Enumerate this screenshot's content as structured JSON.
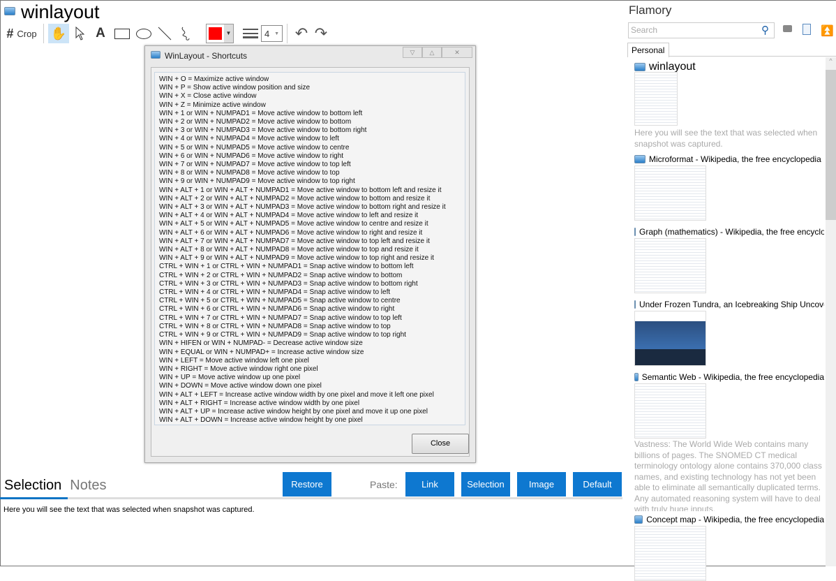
{
  "app": {
    "title": "winlayout"
  },
  "toolbar": {
    "crop_label": "Crop",
    "line_width": "4",
    "color": "#ff0000",
    "tools": [
      "hand",
      "pointer",
      "text",
      "rectangle",
      "ellipse",
      "line",
      "freehand"
    ]
  },
  "dialog": {
    "title": "WinLayout - Shortcuts",
    "close_label": "Close",
    "lines": [
      "WIN + O = Maximize active window",
      "WIN + P = Show active window position and size",
      "WIN + X = Close active window",
      "WIN + Z = Minimize active window",
      "WIN + 1 or WIN + NUMPAD1 = Move active window to bottom left",
      "WIN + 2 or WIN + NUMPAD2 = Move active window to bottom",
      "WIN + 3 or WIN + NUMPAD3 = Move active window to bottom right",
      "WIN + 4 or WIN + NUMPAD4 = Move active window to left",
      "WIN + 5 or WIN + NUMPAD5 = Move active window to centre",
      "WIN + 6 or WIN + NUMPAD6 = Move active window to right",
      "WIN + 7 or WIN + NUMPAD7 = Move active window to top left",
      "WIN + 8 or WIN + NUMPAD8 = Move active window to top",
      "WIN + 9 or WIN + NUMPAD9 = Move active window to top right",
      "WIN + ALT + 1 or WIN + ALT + NUMPAD1 = Move active window to bottom left and resize it",
      "WIN + ALT + 2 or WIN + ALT + NUMPAD2 = Move active window to bottom and resize it",
      "WIN + ALT + 3 or WIN + ALT + NUMPAD3 = Move active window to bottom right and resize it",
      "WIN + ALT + 4 or WIN + ALT + NUMPAD4 = Move active window to left and resize it",
      "WIN + ALT + 5 or WIN + ALT + NUMPAD5 = Move active window to centre and resize it",
      "WIN + ALT + 6 or WIN + ALT + NUMPAD6 = Move active window to right and resize it",
      "WIN + ALT + 7 or WIN + ALT + NUMPAD7 = Move active window to top left and resize it",
      "WIN + ALT + 8 or WIN + ALT + NUMPAD8 = Move active window to top and resize it",
      "WIN + ALT + 9 or WIN + ALT + NUMPAD9 = Move active window to top right and resize it",
      "CTRL + WIN + 1 or CTRL + WIN + NUMPAD1 = Snap active window to bottom left",
      "CTRL + WIN + 2 or CTRL + WIN + NUMPAD2 = Snap active window to bottom",
      "CTRL + WIN + 3 or CTRL + WIN + NUMPAD3 = Snap active window to bottom right",
      "CTRL + WIN + 4 or CTRL + WIN + NUMPAD4 = Snap active window to left",
      "CTRL + WIN + 5 or CTRL + WIN + NUMPAD5 = Snap active window to centre",
      "CTRL + WIN + 6 or CTRL + WIN + NUMPAD6 = Snap active window to right",
      "CTRL + WIN + 7 or CTRL + WIN + NUMPAD7 = Snap active window to top left",
      "CTRL + WIN + 8 or CTRL + WIN + NUMPAD8 = Snap active window to top",
      "CTRL + WIN + 9 or CTRL + WIN + NUMPAD9 = Snap active window to top right",
      "WIN + HIFEN or WIN + NUMPAD- = Decrease active window size",
      "WIN + EQUAL or WIN + NUMPAD+ = Increase active window size",
      "WIN + LEFT = Move active window left one pixel",
      "WIN + RIGHT = Move active window right one pixel",
      "WIN + UP = Move active window up one pixel",
      "WIN + DOWN = Move active window down one pixel",
      "WIN + ALT + LEFT = Increase active window width by one pixel and move it left one pixel",
      "WIN + ALT + RIGHT = Increase active window width by one pixel",
      "WIN + ALT + UP = Increase active window height by one pixel and move it up one pixel",
      "WIN + ALT + DOWN = Increase active window height by one pixel"
    ]
  },
  "bottom": {
    "tab_selection": "Selection",
    "tab_notes": "Notes",
    "restore": "Restore",
    "paste_label": "Paste:",
    "link": "Link",
    "selection": "Selection",
    "image": "Image",
    "default": "Default",
    "selection_text": "Here you will see the text that was selected when snapshot was captured."
  },
  "sidebar": {
    "title": "Flamory",
    "search_placeholder": "Search",
    "tab": "Personal",
    "items": [
      {
        "title": "winlayout",
        "desc": "Here you will see the text that was selected when snapshot was captured."
      },
      {
        "title": "Microformat - Wikipedia, the free encyclopedia"
      },
      {
        "title": "Graph (mathematics) - Wikipedia, the free encyclopedia"
      },
      {
        "title": "Under Frozen Tundra, an Icebreaking Ship Uncovers"
      },
      {
        "title": "Semantic Web - Wikipedia, the free encyclopedia",
        "desc": "Vastness: The World Wide Web contains many billions of pages. The SNOMED CT medical terminology ontology alone contains 370,000 class names, and existing technology has not yet been able to eliminate all semantically duplicated terms. Any automated reasoning system will have to deal with truly huge inputs."
      },
      {
        "title": "Concept map - Wikipedia, the free encyclopedia"
      }
    ]
  }
}
